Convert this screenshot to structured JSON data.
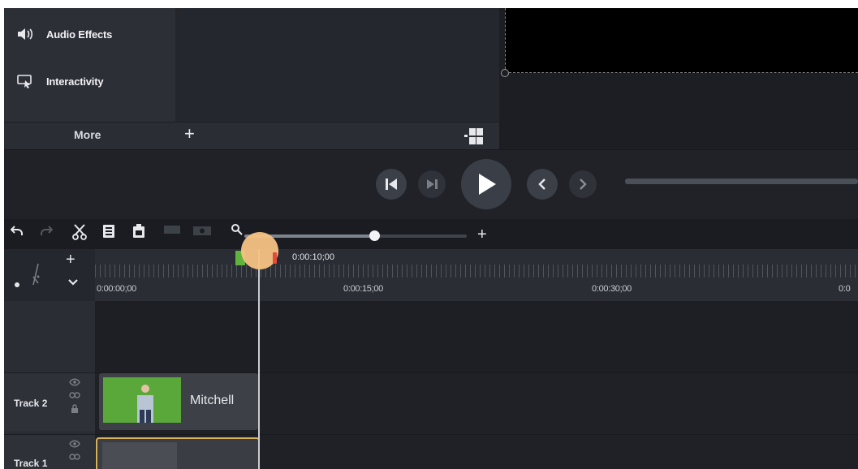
{
  "sidebar": {
    "items": [
      {
        "label": "Audio Effects",
        "icon": "speaker-icon"
      },
      {
        "label": "Interactivity",
        "icon": "interactivity-icon"
      }
    ],
    "more_label": "More"
  },
  "timeline": {
    "playhead_time": "0:00:10;00",
    "ruler_labels": [
      "0:00:00;00",
      "0:00:15;00",
      "0:00:30;00",
      "0:0"
    ],
    "tracks": [
      {
        "name": "Track 2",
        "clip_label": "Mitchell"
      },
      {
        "name": "Track 1",
        "clip_label": ""
      }
    ]
  },
  "colors": {
    "accent_playhead": "#f5c283",
    "clip_border": "#d9b25a",
    "thumb_green": "#5fb33c"
  }
}
